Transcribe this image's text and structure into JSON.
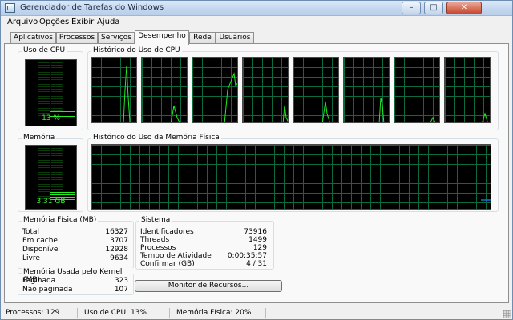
{
  "window": {
    "title": "Gerenciador de Tarefas do Windows"
  },
  "menu": [
    "Arquivo",
    "Opções",
    "Exibir",
    "Ajuda"
  ],
  "tabs": [
    "Aplicativos",
    "Processos",
    "Serviços",
    "Desempenho",
    "Rede",
    "Usuários"
  ],
  "active_tab": "Desempenho",
  "cpu": {
    "label": "Uso de CPU",
    "value": "13 %",
    "usage_fraction": 0.13
  },
  "cpu_history": {
    "label": "Histórico do Uso de CPU",
    "core_count": 8
  },
  "memory": {
    "label": "Memória",
    "value": "3,31 GB",
    "usage_fraction": 0.2
  },
  "memory_history": {
    "label": "Histórico do Uso da Memória Física"
  },
  "physical_memory": {
    "label": "Memória Física (MB)",
    "rows": [
      {
        "label": "Total",
        "value": "16327"
      },
      {
        "label": "Em cache",
        "value": "3707"
      },
      {
        "label": "Disponível",
        "value": "12928"
      },
      {
        "label": "Livre",
        "value": "9634"
      }
    ]
  },
  "kernel_memory": {
    "label": "Memória Usada pelo Kernel (MB)",
    "rows": [
      {
        "label": "Paginada",
        "value": "323"
      },
      {
        "label": "Não paginada",
        "value": "107"
      }
    ]
  },
  "system": {
    "label": "Sistema",
    "rows": [
      {
        "label": "Identificadores",
        "value": "73916"
      },
      {
        "label": "Threads",
        "value": "1499"
      },
      {
        "label": "Processos",
        "value": "129"
      },
      {
        "label": "Tempo de Atividade",
        "value": "0:00:35:57"
      },
      {
        "label": "Confirmar (GB)",
        "value": "4 / 31"
      }
    ]
  },
  "resource_monitor_button": "Monitor de Recursos...",
  "status": {
    "processes": "Processos: 129",
    "cpu": "Uso de CPU: 13%",
    "memory": "Memória Física: 20%"
  },
  "colors": {
    "graph_line": "#22ee22",
    "grid": "#0b6a3e",
    "memory_line": "#1a6fd6"
  }
}
